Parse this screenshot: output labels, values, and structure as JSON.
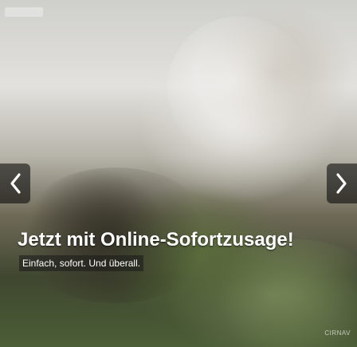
{
  "hero": {
    "headline": "Jetzt mit Online-Sofortzusage!",
    "subline": "Einfach, sofort. Und überall.",
    "watermark": "CIRNAV",
    "colors": {
      "text": "#ffffff",
      "button_bg": "#000000",
      "button_icon": "#ffffff"
    },
    "controls": {
      "prev_icon": "chevron-left-icon",
      "next_icon": "chevron-right-icon"
    }
  }
}
